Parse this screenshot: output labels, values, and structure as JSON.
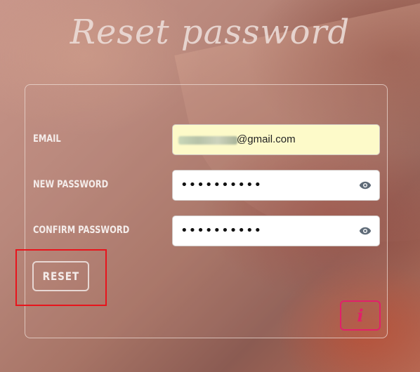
{
  "page": {
    "title": "Reset password"
  },
  "form": {
    "email": {
      "label": "EMAIL",
      "value": "@gmail.com"
    },
    "new_password": {
      "label": "NEW PASSWORD",
      "value": "••••••••••"
    },
    "confirm_password": {
      "label": "CONFIRM PASSWORD",
      "value": "••••••••••"
    },
    "reset_button": {
      "label": "RESET"
    },
    "info_button": {
      "label": "i"
    }
  },
  "icons": {
    "toggle_visibility": "eye-icon",
    "info": "info-icon"
  },
  "colors": {
    "email_field_bg": "#fdfac9",
    "info_accent": "#e1206a",
    "highlight": "#e8141c",
    "label_text": "#f4ecea"
  }
}
